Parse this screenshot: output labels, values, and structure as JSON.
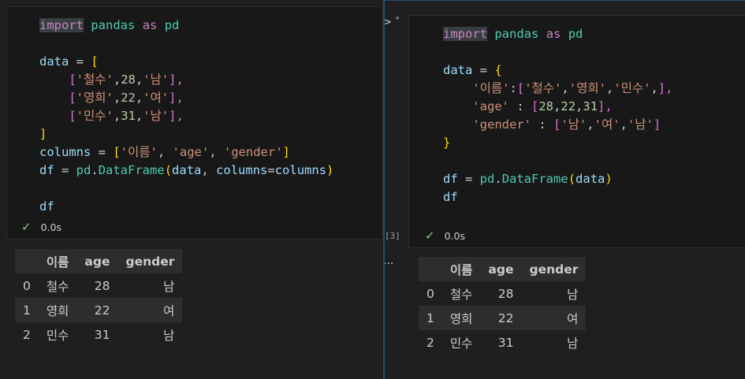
{
  "left_cell": {
    "code": {
      "l1": {
        "kw": "import",
        "mod": "pandas",
        "as": "as",
        "alias": "pd"
      },
      "l3": {
        "var": "data",
        "eq": " = ",
        "open": "["
      },
      "rows": [
        {
          "open": "[",
          "s1": "'철수'",
          "sep1": ",",
          "n": "28",
          "sep2": ",",
          "s2": "'남'",
          "close": "],"
        },
        {
          "open": "[",
          "s1": "'영희'",
          "sep1": ",",
          "n": "22",
          "sep2": ",",
          "s2": "'여'",
          "close": "],"
        },
        {
          "open": "[",
          "s1": "'민수'",
          "sep1": ",",
          "n": "31",
          "sep2": ",",
          "s2": "'남'",
          "close": "],"
        }
      ],
      "l7": {
        "close": "]"
      },
      "l8": {
        "var": "columns",
        "eq": " = ",
        "open": "[",
        "s1": "'이름'",
        "c1": ", ",
        "s2": "'age'",
        "c2": ", ",
        "s3": "'gender'",
        "close": "]"
      },
      "l9": {
        "var": "df",
        "eq": " = ",
        "mod": "pd",
        "dot": ".",
        "cls": "DataFrame",
        "open": "(",
        "arg1": "data",
        "c": ", ",
        "kw": "columns",
        "eq2": "=",
        "arg2": "columns",
        "close": ")"
      },
      "l11": {
        "var": "df"
      }
    },
    "status": {
      "time": "0.0s"
    }
  },
  "right_cell": {
    "exec_count": "[3]",
    "code": {
      "l1": {
        "kw": "import",
        "mod": "pandas",
        "as": "as",
        "alias": "pd"
      },
      "l3": {
        "var": "data",
        "eq": " = ",
        "open": "{"
      },
      "l4": {
        "key": "'이름'",
        "colon": ":",
        "open": "[",
        "s1": "'철수'",
        "c1": ",",
        "s2": "'영희'",
        "c2": ",",
        "s3": "'민수'",
        "c3": ",",
        "close": "],"
      },
      "l5": {
        "key": "'age'",
        "colon": " : ",
        "open": "[",
        "n1": "28",
        "c1": ",",
        "n2": "22",
        "c2": ",",
        "n3": "31",
        "close": "],"
      },
      "l6": {
        "key": "'gender'",
        "colon": " : ",
        "open": "[",
        "s1": "'남'",
        "c1": ",",
        "s2": "'여'",
        "c2": ",",
        "s3": "'남'",
        "close": "]"
      },
      "l7": {
        "close": "}"
      },
      "l9": {
        "var": "df",
        "eq": " = ",
        "mod": "pd",
        "dot": ".",
        "cls": "DataFrame",
        "open": "(",
        "arg": "data",
        "close": ")"
      },
      "l10": {
        "var": "df"
      }
    },
    "status": {
      "time": "0.0s"
    }
  },
  "icons": {
    "check": "✓",
    "chevron": "> ˅",
    "ellipsis": "..."
  },
  "table": {
    "headers": [
      "",
      "이름",
      "age",
      "gender"
    ],
    "rows": [
      [
        "0",
        "철수",
        "28",
        "남"
      ],
      [
        "1",
        "영희",
        "22",
        "여"
      ],
      [
        "2",
        "민수",
        "31",
        "남"
      ]
    ]
  },
  "colors": {
    "keyword": "#c586c0",
    "variable": "#9cdcfe",
    "string": "#ce9178",
    "number": "#b5cea8",
    "class": "#4ec9b0",
    "bracket1": "#ffd700",
    "bracket2": "#da70d6",
    "success": "#89d185",
    "focus_border": "#2b4a7a"
  }
}
